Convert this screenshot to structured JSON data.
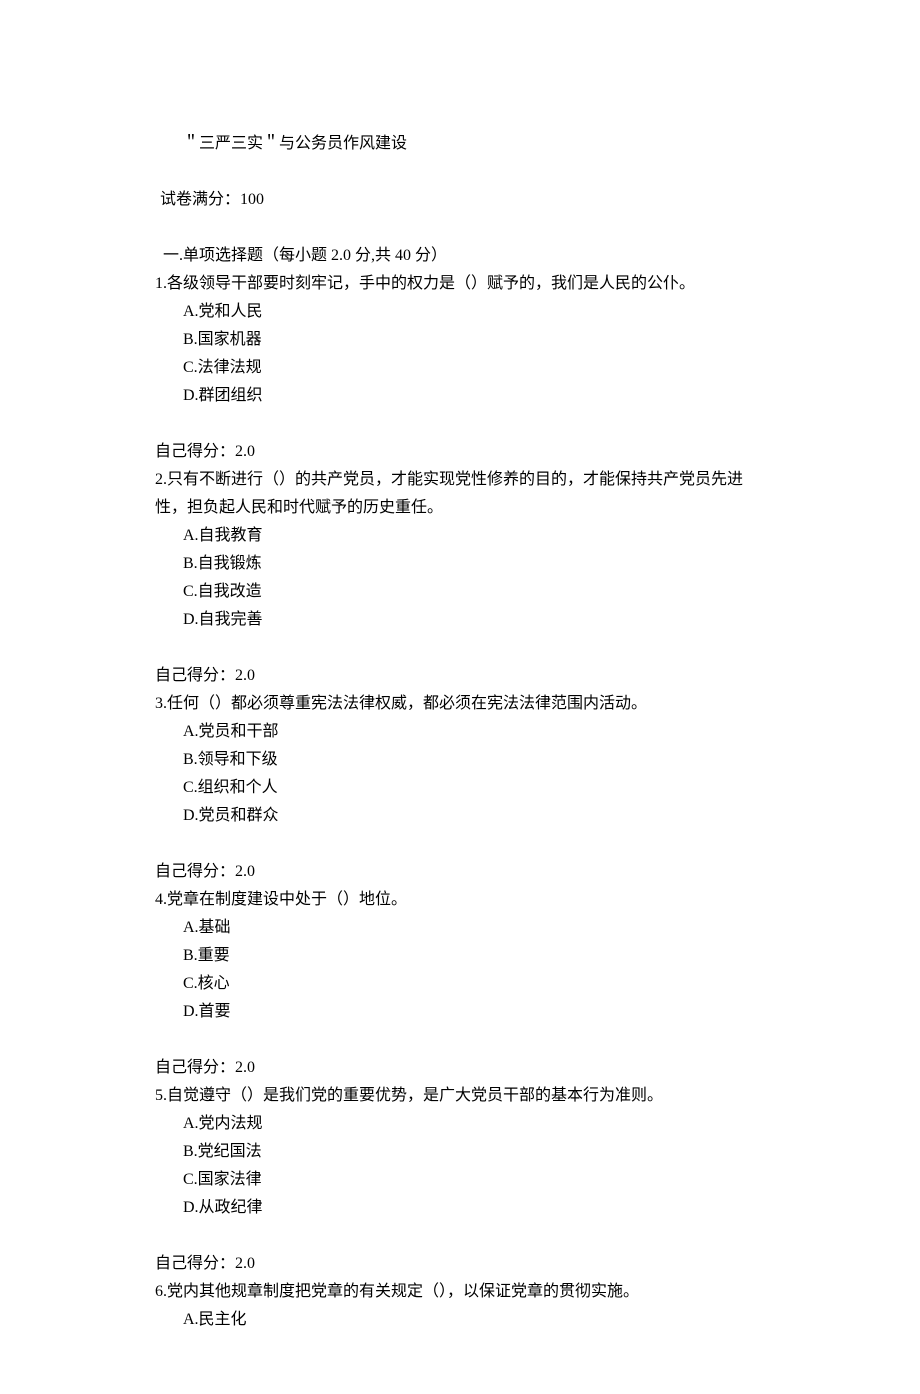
{
  "title": "＂三严三实＂与公务员作风建设",
  "fullscore_label": "试卷满分：100",
  "section_heading": "一.单项选择题（每小题 2.0 分,共 40 分）",
  "score_label": "自己得分：2.0",
  "questions": [
    {
      "num": "1.",
      "text": "各级领导干部要时刻牢记，手中的权力是（）赋予的，我们是人民的公仆。",
      "options": {
        "a": "A.党和人民",
        "b": "B.国家机器",
        "c": "C.法律法规",
        "d": "D.群团组织"
      }
    },
    {
      "num": "2.",
      "text": "只有不断进行（）的共产党员，才能实现党性修养的目的，才能保持共产党员先进性，担负起人民和时代赋予的历史重任。",
      "options": {
        "a": "A.自我教育",
        "b": "B.自我锻炼",
        "c": "C.自我改造",
        "d": "D.自我完善"
      }
    },
    {
      "num": "3.",
      "text": "任何（）都必须尊重宪法法律权威，都必须在宪法法律范围内活动。",
      "options": {
        "a": "A.党员和干部",
        "b": "B.领导和下级",
        "c": "C.组织和个人",
        "d": "D.党员和群众"
      }
    },
    {
      "num": "4.",
      "text": "党章在制度建设中处于（）地位。",
      "options": {
        "a": "A.基础",
        "b": "B.重要",
        "c": "C.核心",
        "d": "D.首要"
      }
    },
    {
      "num": "5.",
      "text": "自觉遵守（）是我们党的重要优势，是广大党员干部的基本行为准则。",
      "options": {
        "a": "A.党内法规",
        "b": "B.党纪国法",
        "c": "C.国家法律",
        "d": "D.从政纪律"
      }
    },
    {
      "num": "6.",
      "text": "党内其他规章制度把党章的有关规定（），以保证党章的贯彻实施。",
      "options": {
        "a": "A.民主化"
      }
    }
  ]
}
